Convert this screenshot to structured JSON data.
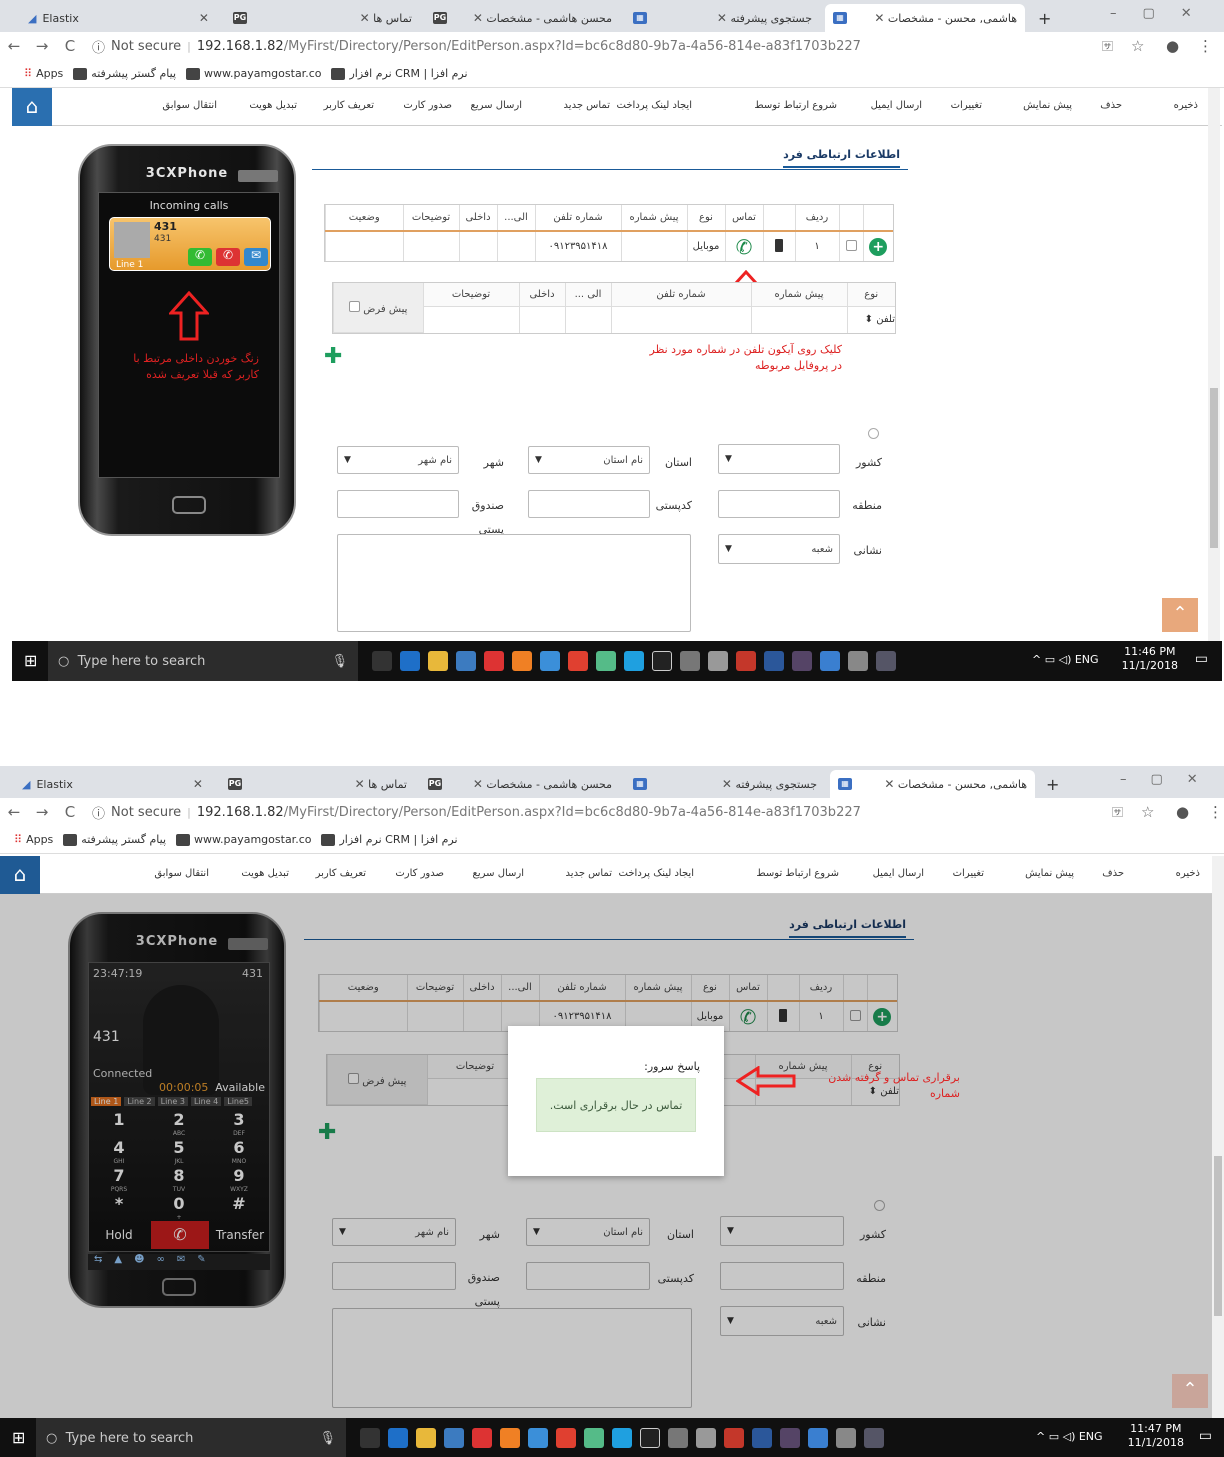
{
  "browser": {
    "tabs": [
      {
        "label": "Elastix"
      },
      {
        "label": "تماس ها"
      },
      {
        "label": "محسن هاشمی - مشخصات"
      },
      {
        "label": "جستجوی پیشرفته"
      },
      {
        "label": "هاشمی, محسن - مشخصات"
      }
    ],
    "new_tab": "+",
    "security": "Not secure",
    "url_host": "192.168.1.82",
    "url_path": "/MyFirst/Directory/Person/EditPerson.aspx?Id=bc6c8d80-9b7a-4a56-814e-a83f1703b227",
    "bookmarks": [
      "Apps",
      "پیام گستر پیشرفته",
      "www.payamgostar.co",
      "نرم افزار CRM | نرم افزا"
    ]
  },
  "toolbar": {
    "items": [
      "ذخیره",
      "حذف",
      "پیش نمایش",
      "تغییرات",
      "ارسال ایمیل",
      "شروع ارتباط توسط",
      "ایجاد لینک پرداخت",
      "تماس جدید",
      "ارسال سریع",
      "صدور کارت",
      "تعریف کاربر",
      "تبدیل هویت",
      "انتقال سوابق"
    ]
  },
  "section_title": "اطلاعات ارتباطی فرد",
  "phones_grid": {
    "headers": [
      "ردیف",
      "تماس",
      "نوع",
      "پیش شماره",
      "شماره تلفن",
      "الی...",
      "داخلی",
      "توضیحات",
      "وضعیت"
    ],
    "row": {
      "index": "۱",
      "type": "موبایل",
      "number": "۰۹۱۲۳۹۵۱۴۱۸"
    }
  },
  "new_phone_grid": {
    "headers": [
      "نوع",
      "پیش شماره",
      "شماره تلفن",
      "الی ...",
      "داخلی",
      "توضیحات"
    ],
    "type_value": "تلفن",
    "default_label": "پیش فرض"
  },
  "address_form": {
    "country_label": "کشور",
    "province_label": "استان",
    "province_placeholder": "نام استان",
    "city_label": "شهر",
    "city_placeholder": "نام شهر",
    "region_label": "منطقه",
    "postal_label": "کدپستی",
    "pobox_label": "صندوق پستی",
    "address_label": "نشانی",
    "branch_value": "شعبه"
  },
  "phone1": {
    "brand": "3CXPhone",
    "incoming_title": "Incoming calls",
    "caller_name": "431",
    "caller_number": "431",
    "line": "Line 1"
  },
  "phone2": {
    "brand": "3CXPhone",
    "time": "23:47:19",
    "ext": "431",
    "caller": "431",
    "status": "Connected",
    "timer": "00:00:05",
    "availability": "Available",
    "lines": [
      "Line 1",
      "Line 2",
      "Line 3",
      "Line 4",
      "Line5"
    ],
    "keys": [
      {
        "d": "1",
        "s": ""
      },
      {
        "d": "2",
        "s": "ABC"
      },
      {
        "d": "3",
        "s": "DEF"
      },
      {
        "d": "4",
        "s": "GHI"
      },
      {
        "d": "5",
        "s": "JKL"
      },
      {
        "d": "6",
        "s": "MNO"
      },
      {
        "d": "7",
        "s": "PQRS"
      },
      {
        "d": "8",
        "s": "TUV"
      },
      {
        "d": "9",
        "s": "WXYZ"
      },
      {
        "d": "*",
        "s": ""
      },
      {
        "d": "0",
        "s": "+"
      },
      {
        "d": "#",
        "s": ""
      }
    ],
    "hold": "Hold",
    "transfer": "Transfer"
  },
  "annotations": {
    "incoming": "زنگ خوردن داخلی مرتبط با کاربر که قبلا تعریف شده",
    "click_icon": "کلیک روی آیکون تلفن در شماره مورد نظر در پروفایل مربوطه",
    "call_made": "برقراری تماس و گرفته شدن شماره"
  },
  "server_dialog": {
    "title": "پاسخ سرور:",
    "message": "تماس در حال برقراری است."
  },
  "taskbar": {
    "search_placeholder": "Type here to search",
    "lang": "ENG",
    "time1": "11:46 PM",
    "time2": "11:47 PM",
    "date": "11/1/2018"
  },
  "colors": {
    "accent": "#2a6fb0",
    "call_green": "#1d8a4a",
    "annotation_red": "#dd2222",
    "dialog_msg_bg": "#dff0d8"
  }
}
